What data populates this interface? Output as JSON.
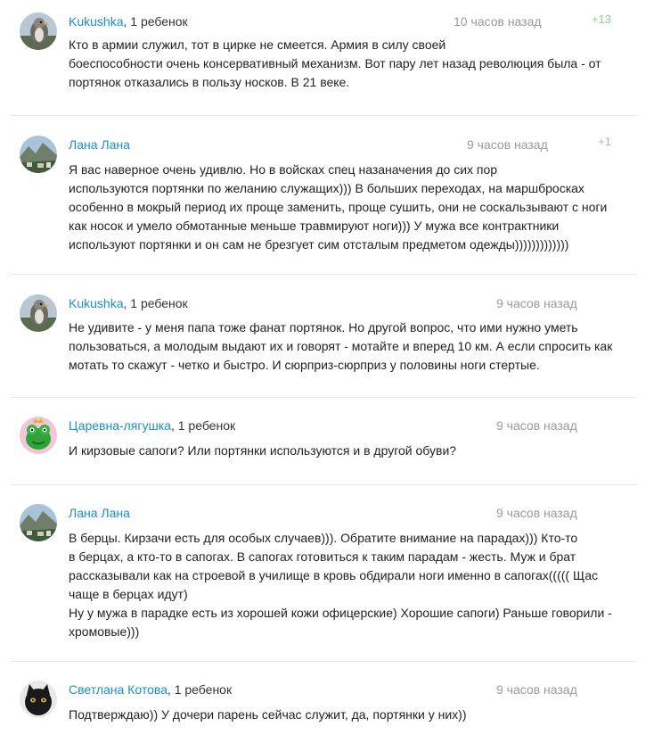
{
  "comments": [
    {
      "author": "Kukushka",
      "meta": ", 1 ребенок",
      "time": "10 часов назад",
      "rating": "+13",
      "avatar": "bird",
      "text": "Кто в армии служил, тот в цирке не смеется. Армия в силу своей\nбоеспособности очень консервативный механизм. Вот пару лет назад революция была - от\nпортянок отказались в пользу носков. В 21 веке."
    },
    {
      "author": "Лана Лана",
      "meta": "",
      "time": "9 часов назад",
      "rating": "+1",
      "avatar": "landscape",
      "text": "Я вас наверное очень удивлю. Но в войсках спец назаначения до сих пор\nиспользуются портянки по желанию служащих))) В больших переходах, на маршбросках\nособенно в мокрый период их проще заменить, проще сушить, они не соскальзывают с ноги\nкак носок и умело обмотанные меньше травмируют ноги))) У мужа все контрактники\nиспользуют портянки и он сам не брезгует сим отсталым предметом одежды)))))))))))))"
    },
    {
      "author": "Kukushka",
      "meta": ", 1 ребенок",
      "time": "9 часов назад",
      "rating": "",
      "avatar": "bird",
      "text": "Не удивите - у меня папа тоже фанат портянок. Но другой вопрос, что ими нужно уметь\nпользоваться, а молодым выдают их и говорят - мотайте и вперед 10 км. А если спросить как\nмотать то скажут - четко и быстро. И сюрприз-сюрприз у половины ноги стертые."
    },
    {
      "author": "Царевна-лягушка",
      "meta": ", 1 ребенок",
      "time": "9 часов назад",
      "rating": "",
      "avatar": "frog",
      "text": "И кирзовые сапоги? Или портянки используются и в другой обуви?"
    },
    {
      "author": "Лана Лана",
      "meta": "",
      "time": "9 часов назад",
      "rating": "",
      "avatar": "landscape",
      "text": "В берцы. Кирзачи есть для особых случаев))). Обратите внимание на парадах))) Кто-то\nв берцах, а кто-то в сапогах. В сапогах готовиться к таким парадам - жесть. Муж и брат\nрассказывали как на строевой в училище в кровь обдирали ноги именно в сапогах((((( Щас\nчаще в берцах идут)\nНу у мужа в парадке есть из хорошей кожи офицерские) Хорошие сапоги) Раньше говорили -\nхромовые)))"
    },
    {
      "author": "Светлана Котова",
      "meta": ", 1 ребенок",
      "time": "9 часов назад",
      "rating": "",
      "avatar": "cat",
      "text": "Подтверждаю)) У дочери парень сейчас служит, да, портянки у них))"
    }
  ]
}
